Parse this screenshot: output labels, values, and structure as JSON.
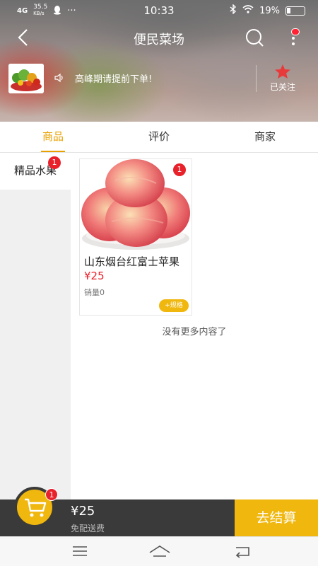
{
  "status": {
    "network": "4G",
    "speed": "35.5",
    "speed_unit": "KB/s",
    "time": "10:33",
    "battery": "19%",
    "more": "···"
  },
  "nav": {
    "title": "便民菜场"
  },
  "shop": {
    "notice": "高峰期请提前下单!",
    "follow_label": "已关注"
  },
  "tabs": [
    {
      "label": "商品",
      "active": true
    },
    {
      "label": "评价",
      "active": false
    },
    {
      "label": "商家",
      "active": false
    }
  ],
  "categories": [
    {
      "label": "精品水果",
      "badge": "1"
    }
  ],
  "products": [
    {
      "name": "山东烟台红富士苹果",
      "price": "¥25",
      "sold": "销量0",
      "spec_label": "+规格",
      "badge": "1"
    }
  ],
  "no_more": "没有更多内容了",
  "cart": {
    "badge": "1",
    "total": "¥25",
    "shipping": "免配送费",
    "checkout_label": "去结算"
  },
  "colors": {
    "accent": "#f0b70e",
    "badge": "#e8212b",
    "tab_active": "#e8a100"
  }
}
